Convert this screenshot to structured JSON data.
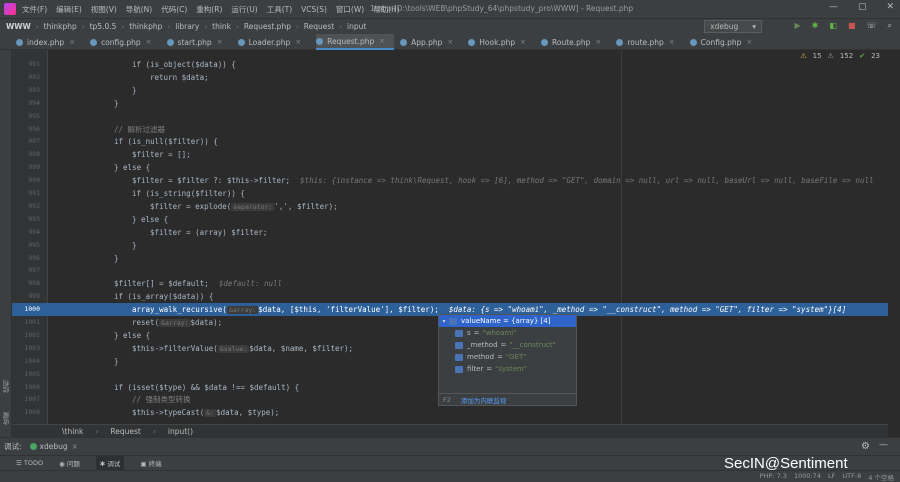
{
  "menu": [
    "文件(F)",
    "编辑(E)",
    "视图(V)",
    "导航(N)",
    "代码(C)",
    "重构(R)",
    "运行(U)",
    "工具(T)",
    "VCS(S)",
    "窗口(W)",
    "帮助(H)"
  ],
  "window_title": "1.php [D:\\tools\\WEB\\phpStudy_64\\phpstudy_pro\\WWW] - Request.php",
  "breadcrumbs": [
    "WWW",
    "thinkphp",
    "tp5.0.5",
    "thinkphp",
    "library",
    "think",
    "Request.php",
    "Request",
    "input"
  ],
  "run_config": "xdebug",
  "tabs": [
    "index.php",
    "config.php",
    "start.php",
    "Loader.php",
    "Request.php",
    "App.php",
    "Hook.php",
    "Route.php",
    "route.php",
    "Config.php"
  ],
  "active_tab": "Request.php",
  "inspections": {
    "warnings": "15",
    "weak": "152",
    "ok": "23"
  },
  "code_lines": [
    {
      "n": "991",
      "code": "if (is_object($data)) {"
    },
    {
      "n": "992",
      "code": "return $data;"
    },
    {
      "n": "993",
      "code": "}"
    },
    {
      "n": "994",
      "code": "}"
    },
    {
      "n": "995",
      "code": ""
    },
    {
      "n": "996",
      "code": "// 解析过滤器"
    },
    {
      "n": "997",
      "code": "if (is_null($filter)) {"
    },
    {
      "n": "998",
      "code": "$filter = [];"
    },
    {
      "n": "999",
      "code": "} else {"
    },
    {
      "n": "990",
      "code": "$filter = $filter ?: $this->filter;",
      "inline": "$this: {instance => think\\Request, hook => [6], method => \"GET\", domain => null, url => null, baseUrl => null, baseFile => null"
    },
    {
      "n": "991",
      "code": "if (is_string($filter)) {"
    },
    {
      "n": "992",
      "code": "$filter = explode(",
      "hint": "separator:",
      "rest": "',', $filter);"
    },
    {
      "n": "993",
      "code": "} else {"
    },
    {
      "n": "994",
      "code": "$filter = (array) $filter;"
    },
    {
      "n": "995",
      "code": "}"
    },
    {
      "n": "996",
      "code": "}"
    },
    {
      "n": "997",
      "code": ""
    },
    {
      "n": "998",
      "code": "$filter[] = $default;",
      "inline": "$default: null"
    },
    {
      "n": "999",
      "code": "if (is_array($data)) {"
    },
    {
      "n": "1000",
      "code": "array_walk_recursive(",
      "hint": "&array:",
      "rest": "$data, [$this, 'filterValue'], $filter);",
      "inline": "$data: {s => \"whoami\", _method => \"__construct\", method => \"GET\", filter => \"system\"}[4]"
    },
    {
      "n": "1001",
      "code": "reset(",
      "hint": "&array:",
      "rest": "$data);"
    },
    {
      "n": "1002",
      "code": "} else {"
    },
    {
      "n": "1003",
      "code": "$this->filterValue(",
      "hint": "&value:",
      "rest": "$data, $name, $filter);"
    },
    {
      "n": "1004",
      "code": "}"
    },
    {
      "n": "1005",
      "code": ""
    },
    {
      "n": "1006",
      "code": "if (isset($type) && $data !== $default) {"
    },
    {
      "n": "1007",
      "code": "// 强制类型转换"
    },
    {
      "n": "1008",
      "code": "$this->typeCast(",
      "hint": "&:",
      "rest": "$data, $type);"
    }
  ],
  "popup": {
    "root": "valueName = {array} [4]",
    "items": [
      {
        "key": "s",
        "value": "\"whoami\""
      },
      {
        "key": "_method",
        "value": "\"__construct\""
      },
      {
        "key": "method",
        "value": "\"GET\""
      },
      {
        "key": "filter",
        "value": "\"system\""
      }
    ],
    "footer_key": "F2",
    "footer_link": "添加为内联监视"
  },
  "bottom_breadcrumbs": [
    "\\think",
    "Request",
    "input()"
  ],
  "debug": {
    "label": "调试:",
    "tab": "xdebug"
  },
  "bottom_tools": [
    "TODO",
    "问题",
    "调试",
    "终端"
  ],
  "status": [
    "PHP: 7.3",
    "1000:74",
    "LF",
    "UTF-8",
    "4 个空格"
  ],
  "watermark": "SecIN@Sentiment"
}
